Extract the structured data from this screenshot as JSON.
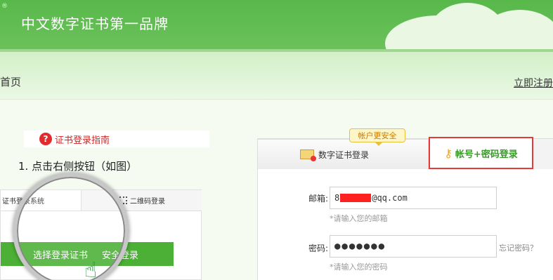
{
  "header": {
    "reg_mark": "®",
    "slogan": "中文数字证书第一品牌"
  },
  "nav": {
    "home": "首页",
    "register": "立即注册"
  },
  "left": {
    "guide_icon": "?",
    "guide_title": "证书登录指南",
    "step_text": "1. 点击右侧按钮（如图）",
    "mock_tab1": "证书登录系统",
    "mock_tab2": "二维码登录",
    "mock_button_left": "选择登录证书",
    "mock_button_right": "安全登录"
  },
  "tabs": {
    "badge": "帐户更安全",
    "cert_tab": "数字证书登录",
    "password_tab": "帐号+密码登录"
  },
  "form": {
    "email_label": "邮箱:",
    "email_prefix": "8",
    "email_suffix": "@qq.com",
    "email_hint": "*请输入您的邮箱",
    "password_label": "密码:",
    "password_value": "●●●●●●●",
    "forgot": "忘记密码？",
    "password_hint": "*请输入您的密码"
  },
  "icons": {
    "help": "question-circle-icon",
    "cert": "certificate-icon",
    "key": "key-icon",
    "hand": "pointer-hand-icon",
    "qr": "qr-code-icon"
  },
  "colors": {
    "brand_green": "#58b84a",
    "button_green": "#4bb035",
    "highlight_red": "#e53a3a"
  }
}
